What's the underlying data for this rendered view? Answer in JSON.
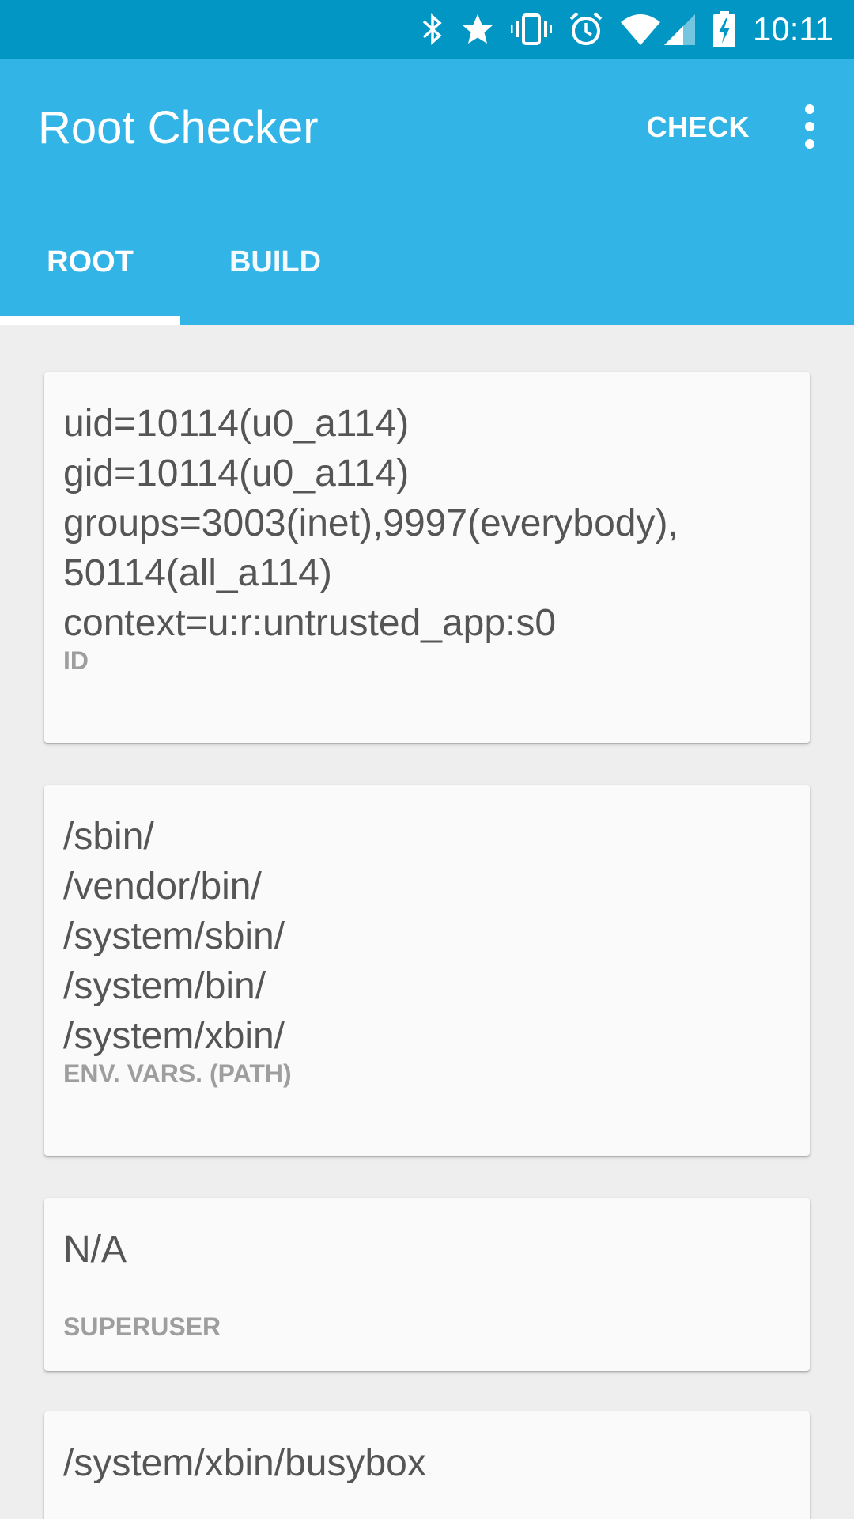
{
  "status_bar": {
    "time": "10:11",
    "icons": [
      "bluetooth-icon",
      "star-icon",
      "vibrate-icon",
      "alarm-icon",
      "wifi-icon",
      "cell-signal-icon",
      "battery-charging-icon"
    ],
    "color": "#0296c5"
  },
  "app_bar": {
    "title": "Root Checker",
    "action_label": "CHECK",
    "overflow_icon": "more-vert-icon",
    "color": "#33b4e6"
  },
  "tabs": [
    {
      "label": "ROOT",
      "selected": true
    },
    {
      "label": "BUILD",
      "selected": false
    }
  ],
  "cards": [
    {
      "value": "uid=10114(u0_a114)\ngid=10114(u0_a114)\ngroups=3003(inet),9997(everybody),\n50114(all_a114)\ncontext=u:r:untrusted_app:s0",
      "label": "ID"
    },
    {
      "value": "/sbin/\n/vendor/bin/\n/system/sbin/\n/system/bin/\n/system/xbin/",
      "label": "ENV. VARS. (PATH)"
    },
    {
      "value": "N/A",
      "label": "SUPERUSER"
    },
    {
      "value": "/system/xbin/busybox",
      "label": ""
    }
  ]
}
